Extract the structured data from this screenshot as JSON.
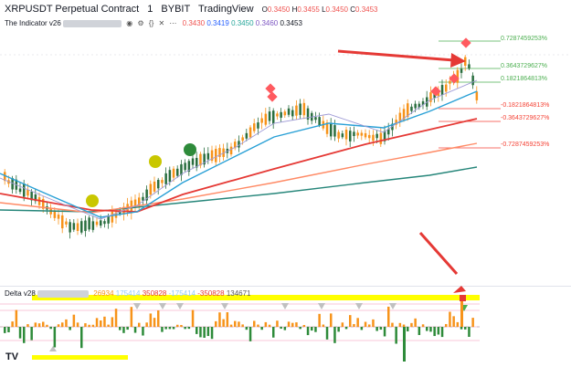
{
  "header": {
    "symbol": "XRPUSDT Perpetual Contract",
    "interval": "1",
    "exchange": "BYBIT",
    "platform": "TradingView",
    "ohlc": {
      "o_label": "O",
      "o": "0.3450",
      "h_label": "H",
      "h": "0.3455",
      "l_label": "L",
      "l": "0.3450",
      "c_label": "C",
      "c": "0.3453"
    }
  },
  "indicator1": {
    "name": "The Indicator v26",
    "values": [
      "0.3430",
      "0.3419",
      "0.3450",
      "0.3460",
      "0.3453"
    ]
  },
  "indicator2": {
    "name": "Delta v28",
    "values": [
      "26934",
      "175414",
      "350828",
      "-175414",
      "-350828",
      "134671"
    ]
  },
  "levels": [
    {
      "label": "0.7287459253%",
      "color": "#4caf50"
    },
    {
      "label": "0.3643729627%",
      "color": "#4caf50"
    },
    {
      "label": "0.1821864813%",
      "color": "#4caf50"
    },
    {
      "label": "-0.1821864813%",
      "color": "#f44336"
    },
    {
      "label": "-0.3643729627%",
      "color": "#f44336"
    },
    {
      "label": "-0.7287459253%",
      "color": "#f44336"
    }
  ],
  "colors": {
    "up": "#f7931a",
    "down": "#2a6e3f",
    "ema_red": "#e53935",
    "ema_orange": "#ff8a65",
    "ema_teal": "#26867a",
    "ema_blue": "#29a0d6",
    "arrow": "#e53935",
    "highlight": "#ffff00"
  },
  "logo": "TV"
}
